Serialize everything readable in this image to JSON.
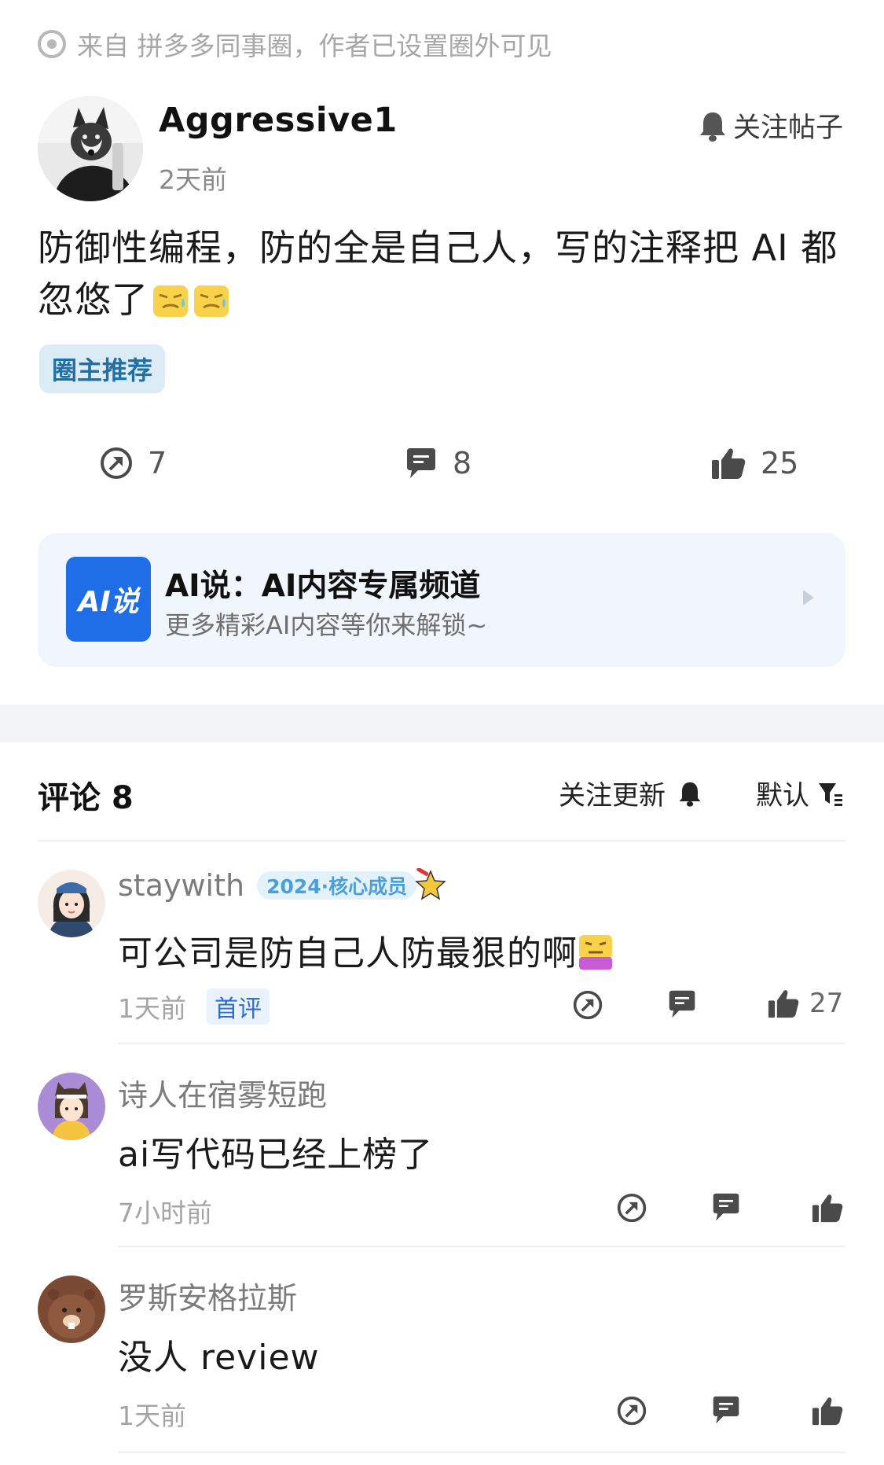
{
  "source": {
    "text": "来自 拼多多同事圈，作者已设置圈外可见"
  },
  "post": {
    "author": "Aggressive1",
    "time": "2天前",
    "follow_label": "关注帖子",
    "text": "防御性编程，防的全是自己人，写的注释把 AI 都忽悠了",
    "tag": "圈主推荐",
    "stats": {
      "shares": "7",
      "comments": "8",
      "likes": "25"
    }
  },
  "channel": {
    "logo": "AI说",
    "title": "AI说：AI内容专属频道",
    "subtitle": "更多精彩AI内容等你来解锁~"
  },
  "comments_header": {
    "title": "评论 8",
    "follow_updates": "关注更新",
    "sort": "默认"
  },
  "comments": [
    {
      "name": "staywith",
      "badge": "2024·核心成员",
      "text": "可公司是防自己人防最狠的啊",
      "time": "1天前",
      "first": "首评",
      "likes": "27"
    },
    {
      "name": "诗人在宿雾短跑",
      "text": "ai写代码已经上榜了",
      "time": "7小时前"
    },
    {
      "name": "罗斯安格拉斯",
      "text": "没人 review",
      "time": "1天前"
    }
  ],
  "colors": {
    "accent_blue": "#1f6ee8",
    "tag_text": "#1f6fa8",
    "tag_bg": "#dcecf6",
    "muted": "#a5a5a5"
  }
}
